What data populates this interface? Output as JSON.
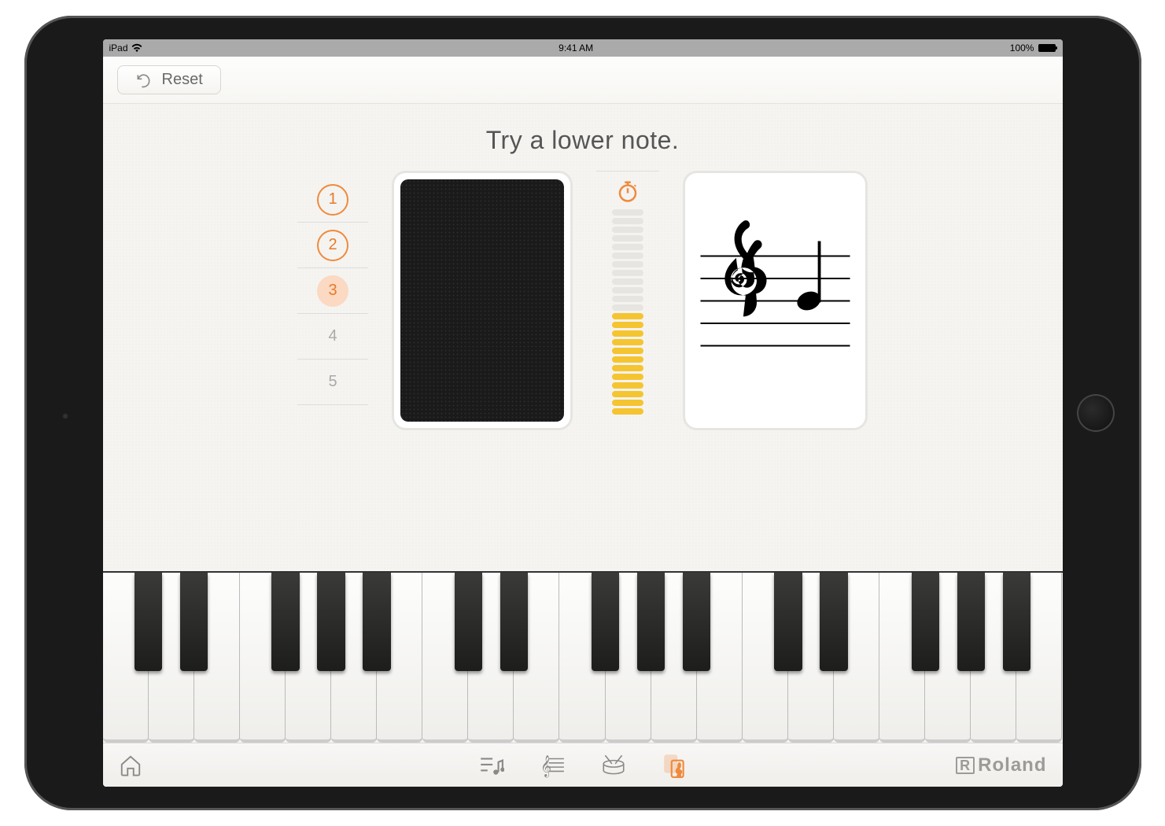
{
  "statusbar": {
    "device": "iPad",
    "time": "9:41 AM",
    "battery": "100%"
  },
  "toolbar": {
    "reset_label": "Reset"
  },
  "hint_text": "Try a lower note.",
  "levels": [
    {
      "n": "1",
      "state": "completed"
    },
    {
      "n": "2",
      "state": "completed"
    },
    {
      "n": "3",
      "state": "current"
    },
    {
      "n": "4",
      "state": "future"
    },
    {
      "n": "5",
      "state": "future"
    }
  ],
  "timer": {
    "total_bars": 24,
    "filled_bars": 12
  },
  "note_card": {
    "clef": "treble",
    "note": "B4-quarter"
  },
  "piano": {
    "white_keys": 21,
    "black_pattern": [
      1,
      1,
      0,
      1,
      1,
      1,
      0
    ]
  },
  "tabs": [
    {
      "name": "home",
      "active": false
    },
    {
      "name": "song-list",
      "active": false
    },
    {
      "name": "score",
      "active": false
    },
    {
      "name": "rhythm",
      "active": false
    },
    {
      "name": "flash-card",
      "active": true
    }
  ],
  "brand": "Roland",
  "colors": {
    "accent": "#f08a3c",
    "yellow": "#f5c431"
  }
}
